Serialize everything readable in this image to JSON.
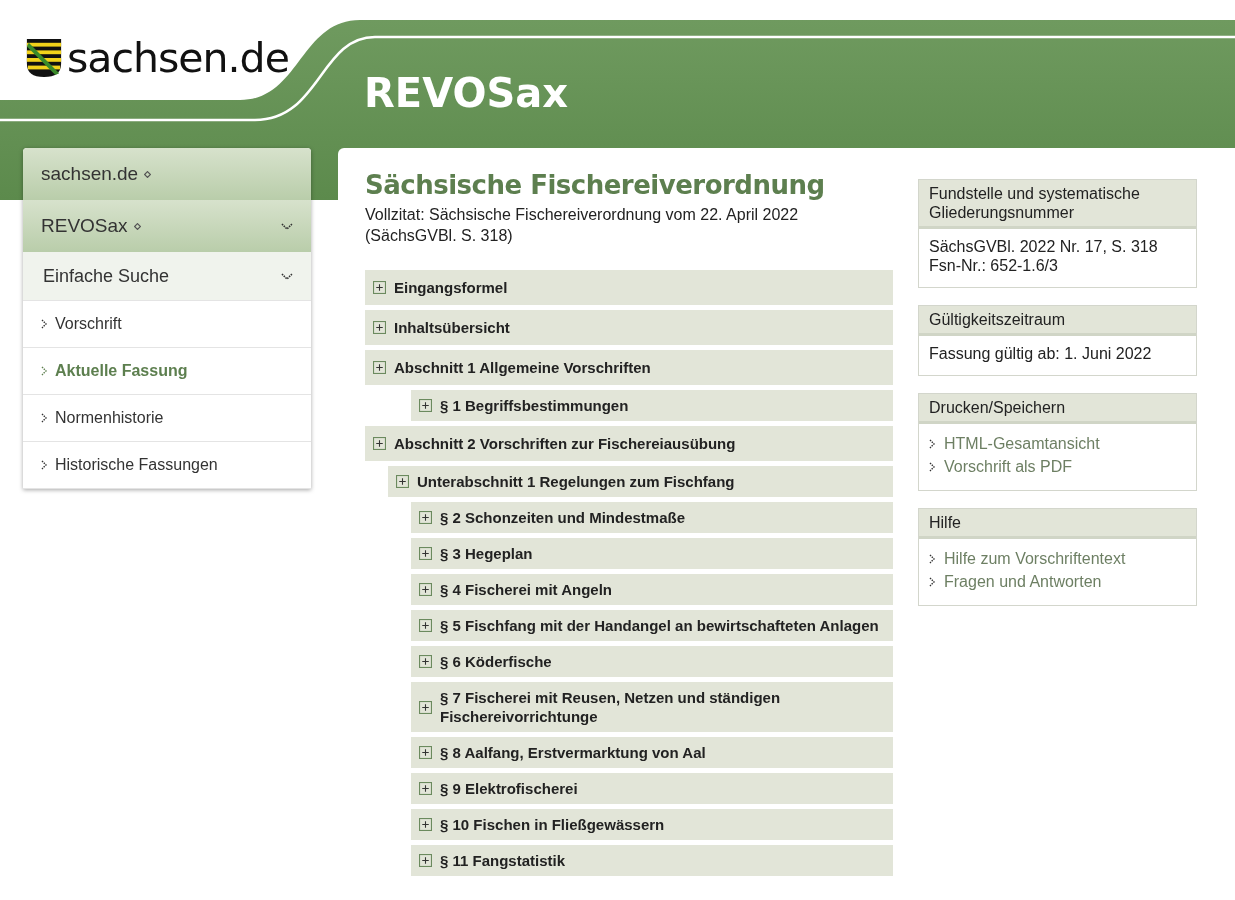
{
  "header": {
    "logo_text": "sachsen.de",
    "title": "REVOSax"
  },
  "sidebar": {
    "items": [
      {
        "label": "sachsen.de",
        "kind": "portal",
        "expanded": false
      },
      {
        "label": "REVOSax",
        "kind": "portal",
        "expanded": true
      },
      {
        "label": "Einfache Suche",
        "kind": "section",
        "expanded": true
      },
      {
        "label": "Vorschrift",
        "kind": "link",
        "selected": false
      },
      {
        "label": "Aktuelle Fassung",
        "kind": "link",
        "selected": true
      },
      {
        "label": "Normenhistorie",
        "kind": "link",
        "selected": false
      },
      {
        "label": "Historische Fassungen",
        "kind": "link",
        "selected": false
      }
    ]
  },
  "document": {
    "title": "Sächsische Fischereiverordnung",
    "citation": "Vollzitat: Sächsische Fischereiverordnung  vom 22. April 2022 (SächsGVBl. S. 318)",
    "outline": [
      {
        "label": "Eingangsformel",
        "kind": "section",
        "expanded": false
      },
      {
        "label": "Inhaltsübersicht",
        "kind": "section",
        "expanded": false
      },
      {
        "label": "Abschnitt 1 Allgemeine Vorschriften",
        "kind": "section",
        "expanded": false,
        "children": [
          {
            "label": "§ 1 Begriffsbestimmungen",
            "kind": "paragraph",
            "expanded": false
          }
        ]
      },
      {
        "label": "Abschnitt 2 Vorschriften zur Fischereiausübung",
        "kind": "section",
        "expanded": false,
        "children": [
          {
            "label": "Unterabschnitt 1 Regelungen zum Fischfang",
            "kind": "subsection",
            "expanded": false,
            "children": [
              {
                "label": "§ 2 Schonzeiten und Mindestmaße",
                "kind": "paragraph",
                "expanded": false
              },
              {
                "label": "§ 3 Hegeplan",
                "kind": "paragraph",
                "expanded": false
              },
              {
                "label": "§ 4 Fischerei mit Angeln",
                "kind": "paragraph",
                "expanded": false
              },
              {
                "label": "§ 5 Fischfang mit der Handangel an bewirtschafteten Anlagen",
                "kind": "paragraph",
                "expanded": false
              },
              {
                "label": "§ 6 Köderfische",
                "kind": "paragraph",
                "expanded": false
              },
              {
                "label": "§ 7 Fischerei mit Reusen, Netzen und ständigen Fischereivorrichtunge",
                "kind": "paragraph",
                "expanded": false
              },
              {
                "label": "§ 8 Aalfang, Erstvermarktung von Aal",
                "kind": "paragraph",
                "expanded": false
              },
              {
                "label": "§ 9 Elektrofischerei",
                "kind": "paragraph",
                "expanded": false
              },
              {
                "label": "§ 10 Fischen in Fließgewässern",
                "kind": "paragraph",
                "expanded": false
              },
              {
                "label": "§ 11 Fangstatistik",
                "kind": "paragraph",
                "expanded": false
              }
            ]
          }
        ]
      }
    ]
  },
  "info_boxes": [
    {
      "title": "Fundstelle und systematische Gliederungsnummer",
      "kind": "text",
      "lines": [
        "SächsGVBl. 2022 Nr. 17, S. 318",
        "Fsn-Nr.: 652-1.6/3"
      ]
    },
    {
      "title": "Gültigkeitszeitraum",
      "kind": "text",
      "lines": [
        "Fassung gültig ab: 1. Juni 2022"
      ]
    },
    {
      "title": "Drucken/Speichern",
      "kind": "links",
      "lines": [
        "HTML-Gesamtansicht",
        "Vorschrift als PDF"
      ]
    },
    {
      "title": "Hilfe",
      "kind": "links",
      "lines": [
        "Hilfe zum Vorschriftentext",
        "Fragen und Antworten"
      ]
    }
  ]
}
